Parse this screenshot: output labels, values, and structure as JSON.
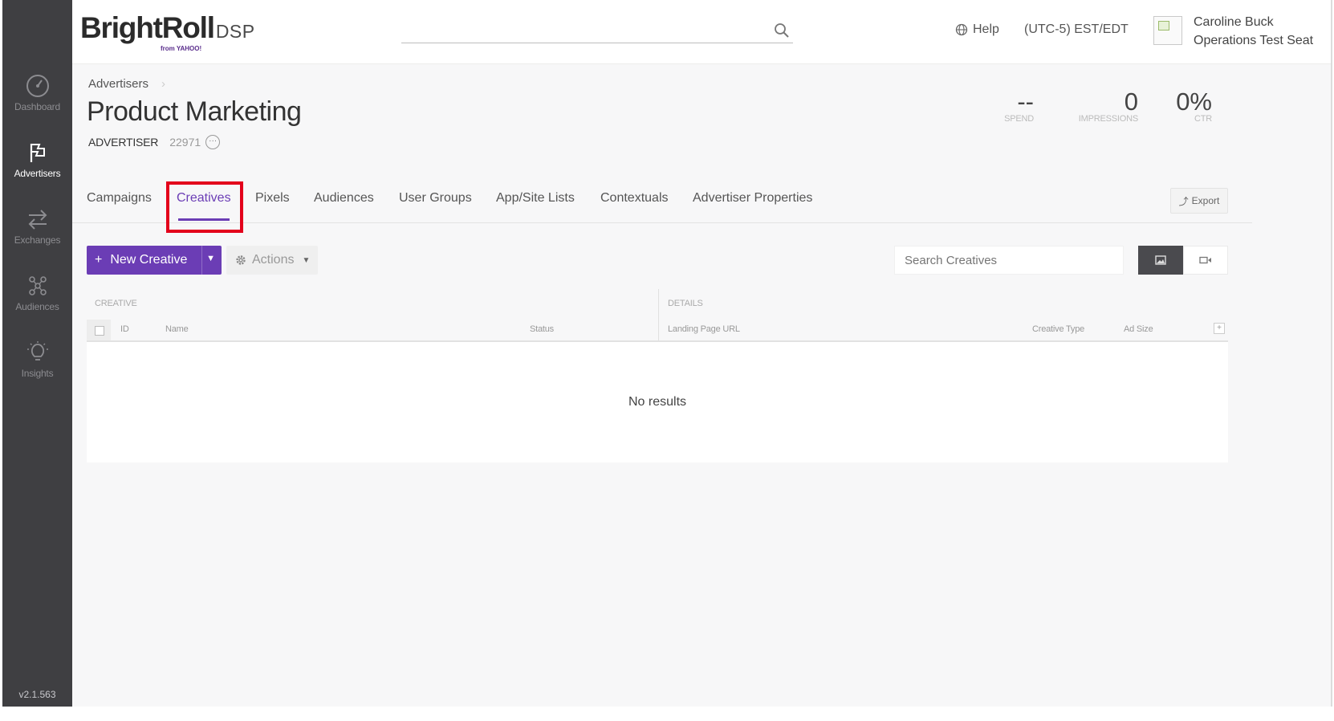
{
  "brand": {
    "name": "BrightRoll",
    "product": "DSP",
    "sub": "from YAHOO!"
  },
  "header": {
    "search_placeholder": "",
    "help_label": "Help",
    "timezone": "(UTC-5) EST/EDT",
    "user_name": "Caroline Buck",
    "user_seat": "Operations Test Seat"
  },
  "sidebar": {
    "items": [
      {
        "label": "Dashboard",
        "icon": "gauge-icon",
        "active": false
      },
      {
        "label": "Advertisers",
        "icon": "flag-icon",
        "active": true
      },
      {
        "label": "Exchanges",
        "icon": "exchange-arrows-icon",
        "active": false
      },
      {
        "label": "Audiences",
        "icon": "audience-network-icon",
        "active": false
      },
      {
        "label": "Insights",
        "icon": "lightbulb-icon",
        "active": false
      }
    ],
    "version": "v2.1.563"
  },
  "breadcrumb": {
    "root": "Advertisers"
  },
  "page": {
    "title": "Product Marketing",
    "type_label": "ADVERTISER",
    "id": "22971"
  },
  "stats": {
    "spend": {
      "value": "--",
      "label": "SPEND"
    },
    "impressions": {
      "value": "0",
      "label": "IMPRESSIONS"
    },
    "ctr": {
      "value": "0%",
      "label": "CTR"
    }
  },
  "tabs": [
    {
      "label": "Campaigns",
      "active": false
    },
    {
      "label": "Creatives",
      "active": true
    },
    {
      "label": "Pixels",
      "active": false
    },
    {
      "label": "Audiences",
      "active": false
    },
    {
      "label": "User Groups",
      "active": false
    },
    {
      "label": "App/Site Lists",
      "active": false
    },
    {
      "label": "Contextuals",
      "active": false
    },
    {
      "label": "Advertiser Properties",
      "active": false
    }
  ],
  "export_label": "Export",
  "toolbar": {
    "new_label": "New Creative",
    "actions_label": "Actions",
    "search_placeholder": "Search Creatives"
  },
  "table": {
    "group_creative": "CREATIVE",
    "group_details": "DETAILS",
    "columns": {
      "id": "ID",
      "name": "Name",
      "status": "Status",
      "landing_url": "Landing Page URL",
      "creative_type": "Creative Type",
      "ad_size": "Ad Size"
    },
    "empty_text": "No results"
  },
  "colors": {
    "accent": "#6b3db5",
    "sidebar_bg": "#3f3f42",
    "highlight": "#e3001b"
  }
}
